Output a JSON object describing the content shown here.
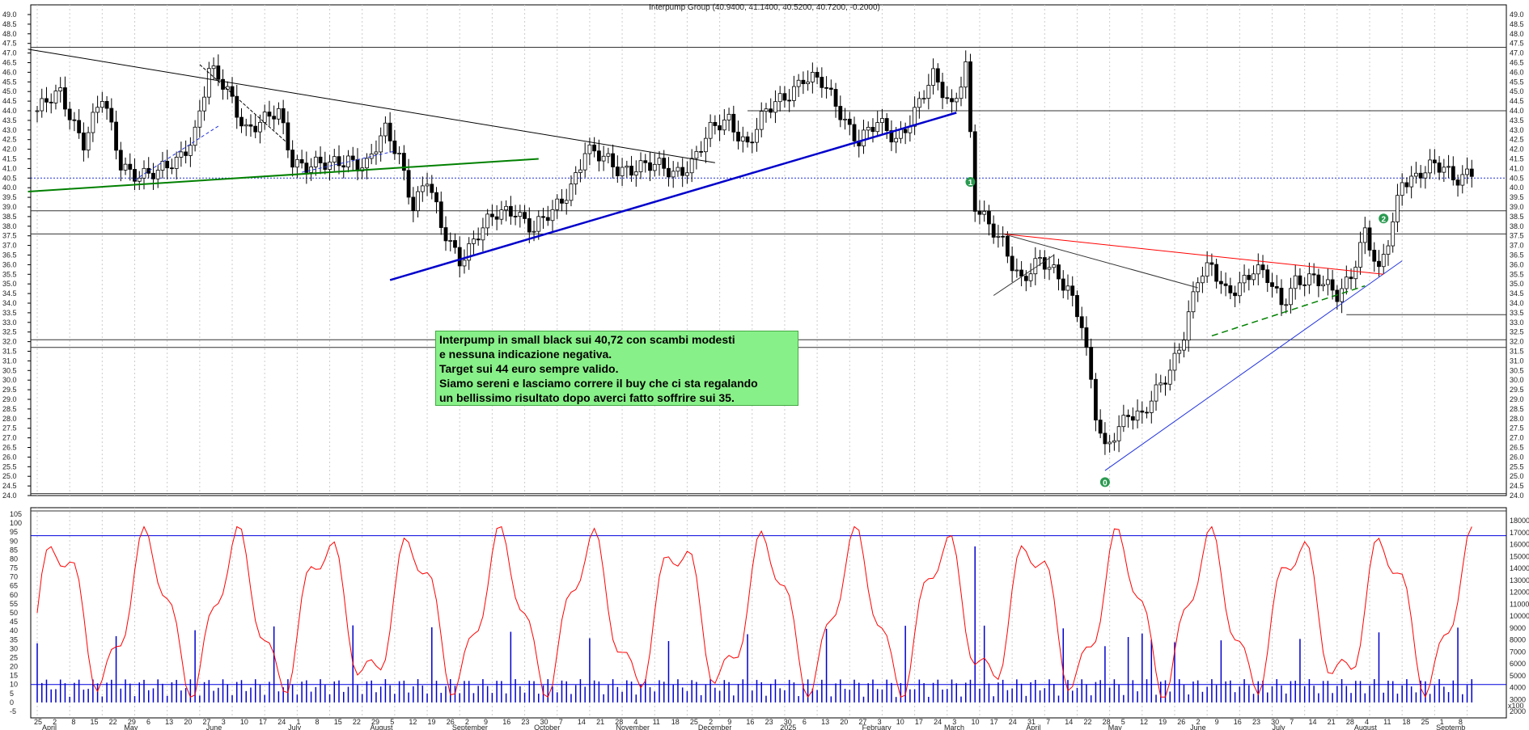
{
  "chart_data": [
    {
      "type": "candlestick",
      "title": "Interpump Group (40.9400, 41.1400, 40.5200, 40.7200, -0.2000)",
      "ylim": [
        24.0,
        49.0
      ],
      "y_ticks": [
        "24.0",
        "24.5",
        "25.0",
        "25.5",
        "26.0",
        "26.5",
        "27.0",
        "27.5",
        "28.0",
        "28.5",
        "29.0",
        "29.5",
        "30.0",
        "30.5",
        "31.0",
        "31.5",
        "32.0",
        "32.5",
        "33.0",
        "33.5",
        "34.0",
        "34.5",
        "35.0",
        "35.5",
        "36.0",
        "36.5",
        "37.0",
        "37.5",
        "38.0",
        "38.5",
        "39.0",
        "39.5",
        "40.0",
        "40.5",
        "41.0",
        "41.5",
        "42.0",
        "42.5",
        "43.0",
        "43.5",
        "44.0",
        "44.5",
        "45.0",
        "45.5",
        "46.0",
        "46.5",
        "47.0",
        "47.5",
        "48.0",
        "48.5",
        "49.0"
      ],
      "close_path": [
        [
          0,
          44.0
        ],
        [
          5,
          44.8
        ],
        [
          10,
          42.5
        ],
        [
          14,
          44.6
        ],
        [
          18,
          41.2
        ],
        [
          22,
          40.8
        ],
        [
          26,
          40.6
        ],
        [
          30,
          41.4
        ],
        [
          34,
          43.0
        ],
        [
          37,
          46.0
        ],
        [
          41,
          45.0
        ],
        [
          45,
          43.2
        ],
        [
          49,
          43.4
        ],
        [
          52,
          43.8
        ],
        [
          55,
          41.5
        ],
        [
          59,
          41.2
        ],
        [
          63,
          41.0
        ],
        [
          67,
          41.6
        ],
        [
          71,
          41.2
        ],
        [
          75,
          42.8
        ],
        [
          78,
          41.7
        ],
        [
          81,
          39.2
        ],
        [
          84,
          40.4
        ],
        [
          87,
          37.8
        ],
        [
          91,
          36.4
        ],
        [
          95,
          37.6
        ],
        [
          99,
          38.5
        ],
        [
          103,
          39.0
        ],
        [
          107,
          37.8
        ],
        [
          111,
          38.6
        ],
        [
          115,
          40.2
        ],
        [
          118,
          42.0
        ],
        [
          121,
          41.5
        ],
        [
          125,
          41.0
        ],
        [
          129,
          41.2
        ],
        [
          133,
          41.0
        ],
        [
          137,
          40.8
        ],
        [
          141,
          41.4
        ],
        [
          145,
          42.8
        ],
        [
          149,
          43.6
        ],
        [
          153,
          42.3
        ],
        [
          157,
          43.8
        ],
        [
          161,
          44.8
        ],
        [
          165,
          45.8
        ],
        [
          169,
          45.3
        ],
        [
          173,
          44.0
        ],
        [
          177,
          42.5
        ],
        [
          181,
          43.2
        ],
        [
          185,
          42.6
        ],
        [
          189,
          44.0
        ],
        [
          193,
          45.6
        ],
        [
          197,
          44.3
        ],
        [
          200,
          46.5
        ],
        [
          202,
          39.0
        ],
        [
          205,
          37.8
        ],
        [
          208,
          37.2
        ],
        [
          212,
          35.3
        ],
        [
          216,
          36.0
        ],
        [
          219,
          35.6
        ],
        [
          222,
          35.0
        ],
        [
          225,
          33.0
        ],
        [
          228,
          28.0
        ],
        [
          230,
          26.2
        ],
        [
          232,
          27.3
        ],
        [
          235,
          28.5
        ],
        [
          238,
          28.0
        ],
        [
          241,
          29.2
        ],
        [
          244,
          30.6
        ],
        [
          247,
          32.6
        ],
        [
          250,
          35.2
        ],
        [
          253,
          35.7
        ],
        [
          256,
          34.7
        ],
        [
          259,
          35.1
        ],
        [
          262,
          35.6
        ],
        [
          265,
          35.2
        ],
        [
          268,
          34.1
        ],
        [
          271,
          35.3
        ],
        [
          274,
          35.1
        ],
        [
          277,
          34.9
        ],
        [
          280,
          34.6
        ],
        [
          283,
          35.6
        ],
        [
          286,
          37.5
        ],
        [
          289,
          35.4
        ],
        [
          292,
          38.4
        ],
        [
          294,
          40.6
        ],
        [
          297,
          40.4
        ],
        [
          300,
          40.9
        ],
        [
          303,
          41.2
        ],
        [
          305,
          40.7
        ]
      ],
      "lines": [
        "horizontal resistance/support levels",
        "trendlines",
        "dotted price line at 40.72"
      ],
      "annotations": [
        {
          "label": "1",
          "x": 201,
          "y": 40.3
        },
        {
          "label": "2",
          "x": 290,
          "y": 38.4
        },
        {
          "label": "0",
          "x": 230,
          "y": 24.7
        }
      ],
      "note": [
        "Interpump in small black sui 40,72 con scambi modesti",
        "e nessuna indicazione negativa.",
        "Target sui 44 euro sempre valido.",
        "Siamo sereni e lasciamo correre il buy che ci sta regalando",
        "un bellissimo risultato dopo averci fatto soffrire sui 35."
      ]
    },
    {
      "type": "line+bar",
      "left_ticks": [
        "-5",
        "0",
        "5",
        "10",
        "15",
        "20",
        "25",
        "30",
        "35",
        "40",
        "45",
        "50",
        "55",
        "60",
        "65",
        "70",
        "75",
        "80",
        "85",
        "90",
        "95",
        "100",
        "105"
      ],
      "right_ticks": [
        "2000",
        "3000",
        "4000",
        "5000",
        "6000",
        "7000",
        "8000",
        "9000",
        "10000",
        "11000",
        "12000",
        "13000",
        "14000",
        "15000",
        "16000",
        "17000",
        "18000"
      ],
      "right_unit": "x100",
      "hlines": [
        10,
        93
      ],
      "series": [
        {
          "color": "#ff0000"
        },
        {
          "color": "#0000ff"
        }
      ]
    }
  ],
  "x_axis": {
    "days": [
      "25",
      "2",
      "8",
      "15",
      "22",
      "29",
      "6",
      "13",
      "20",
      "27",
      "3",
      "10",
      "17",
      "24",
      "1",
      "8",
      "15",
      "22",
      "29",
      "5",
      "12",
      "19",
      "26",
      "2",
      "9",
      "16",
      "23",
      "30",
      "7",
      "14",
      "21",
      "28",
      "4",
      "11",
      "18",
      "25",
      "2",
      "9",
      "16",
      "23",
      "30",
      "6",
      "13",
      "20",
      "27",
      "3",
      "10",
      "17",
      "24",
      "3",
      "10",
      "17",
      "24",
      "31",
      "7",
      "14",
      "22",
      "28",
      "5",
      "12",
      "19",
      "26",
      "2",
      "9",
      "16",
      "23",
      "30",
      "7",
      "14",
      "21",
      "28",
      "4",
      "11",
      "18",
      "25",
      "1",
      "8"
    ],
    "months": [
      "April",
      "May",
      "June",
      "July",
      "August",
      "September",
      "October",
      "November",
      "December",
      "2025",
      "February",
      "March",
      "April",
      "May",
      "June",
      "July",
      "August",
      "Septemb"
    ]
  }
}
